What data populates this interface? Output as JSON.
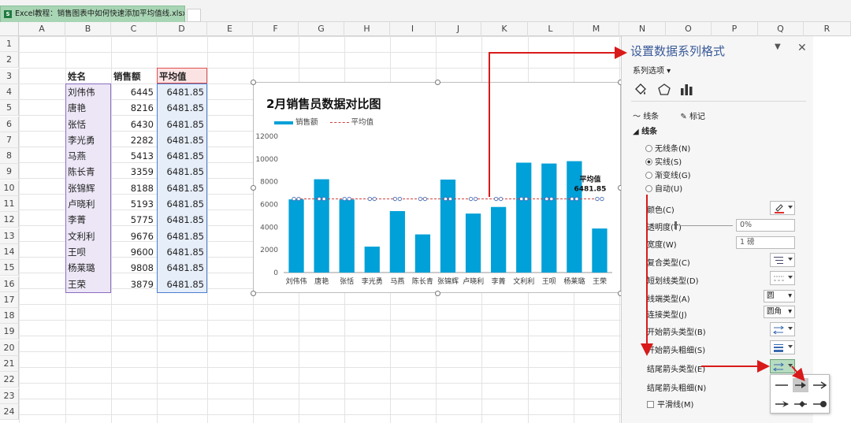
{
  "window": {
    "tab_title": "Excel教程：销售图表中如何快速添加平均值线.xlsx *",
    "app_icon": "excel-icon"
  },
  "columns": [
    "A",
    "B",
    "C",
    "D",
    "E",
    "F",
    "G",
    "H",
    "I",
    "J",
    "K",
    "L",
    "M",
    "N",
    "O",
    "P",
    "Q",
    "R"
  ],
  "rows": [
    "1",
    "2",
    "3",
    "4",
    "5",
    "6",
    "7",
    "8",
    "9",
    "10",
    "11",
    "12",
    "13",
    "14",
    "15",
    "16",
    "17",
    "18",
    "19",
    "20",
    "21",
    "22",
    "23",
    "24"
  ],
  "table": {
    "headers": [
      "姓名",
      "销售额",
      "平均值"
    ],
    "rows": [
      [
        "刘伟伟",
        "6445",
        "6481.85"
      ],
      [
        "唐艳",
        "8216",
        "6481.85"
      ],
      [
        "张恬",
        "6430",
        "6481.85"
      ],
      [
        "李光勇",
        "2282",
        "6481.85"
      ],
      [
        "马燕",
        "5413",
        "6481.85"
      ],
      [
        "陈长青",
        "3359",
        "6481.85"
      ],
      [
        "张锦辉",
        "8188",
        "6481.85"
      ],
      [
        "卢晓利",
        "5193",
        "6481.85"
      ],
      [
        "李菁",
        "5775",
        "6481.85"
      ],
      [
        "文利利",
        "9676",
        "6481.85"
      ],
      [
        "王呗",
        "9600",
        "6481.85"
      ],
      [
        "杨莱璐",
        "9808",
        "6481.85"
      ],
      [
        "王荣",
        "3879",
        "6481.85"
      ]
    ]
  },
  "chart_data": {
    "type": "bar",
    "title": "2月销售员数据对比图",
    "categories": [
      "刘伟伟",
      "唐艳",
      "张恬",
      "李光勇",
      "马燕",
      "陈长青",
      "张锦辉",
      "卢晓利",
      "李菁",
      "文利利",
      "王呗",
      "杨莱璐",
      "王荣"
    ],
    "series": [
      {
        "name": "销售额",
        "type": "bar",
        "color": "#00a0d8",
        "values": [
          6445,
          8216,
          6430,
          2282,
          5413,
          3359,
          8188,
          5193,
          5775,
          9676,
          9600,
          9808,
          3879
        ]
      },
      {
        "name": "平均值",
        "type": "line",
        "style": "dashed",
        "color": "#d04040",
        "values": [
          6481.85,
          6481.85,
          6481.85,
          6481.85,
          6481.85,
          6481.85,
          6481.85,
          6481.85,
          6481.85,
          6481.85,
          6481.85,
          6481.85,
          6481.85
        ]
      }
    ],
    "ylim": [
      0,
      12000
    ],
    "yticks": [
      "0",
      "2000",
      "4000",
      "6000",
      "8000",
      "10000",
      "12000"
    ],
    "annotation": {
      "label": "平均值",
      "value": "6481.85"
    },
    "legend": "top-left",
    "grid": false
  },
  "pane": {
    "title": "设置数据系列格式",
    "series_options": "系列选项",
    "tabs": [
      "线条",
      "标记"
    ],
    "group": "线条",
    "radios": [
      "无线条(N)",
      "实线(S)",
      "渐变线(G)",
      "自动(U)"
    ],
    "selected_radio": 1,
    "props": {
      "color": "颜色(C)",
      "transparency": "透明度(T)",
      "transparency_value": "0%",
      "width": "宽度(W)",
      "width_value": "1 磅",
      "compound": "复合类型(C)",
      "dash": "短划线类型(D)",
      "cap": "线端类型(A)",
      "cap_value": "圆",
      "join": "连接类型(J)",
      "join_value": "圆角",
      "begin_arrow": "开始箭头类型(B)",
      "begin_size": "开始箭头粗细(S)",
      "end_arrow": "结尾箭头类型(E)",
      "end_size": "结尾箭头粗细(N)",
      "smooth": "平滑线(M)"
    }
  },
  "colors": {
    "bar": "#00a0d8",
    "avg_line": "#d04040",
    "annotation_arrow": "#d91a1a",
    "pane_title": "#3a5a9a"
  }
}
